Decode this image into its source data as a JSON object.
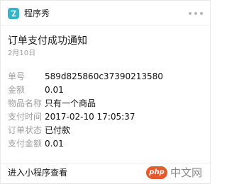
{
  "header": {
    "app_name": "程序秀",
    "icon": "mini-program-icon",
    "more_icon": "more-icon"
  },
  "message": {
    "title": "订单支付成功通知",
    "date": "2月10日"
  },
  "details": [
    {
      "label": "单号",
      "value": "589d825860c37390213580"
    },
    {
      "label": "金额",
      "value": "0.01"
    },
    {
      "label": "物品名称",
      "value": "只有一个商品"
    },
    {
      "label": "支付时间",
      "value": "2017-02-10 17:05:37"
    },
    {
      "label": "订单状态",
      "value": "已付款"
    },
    {
      "label": "支付金额",
      "value": "0.01"
    }
  ],
  "footer": {
    "link_label": "进入小程序查看"
  },
  "watermark": {
    "logo_text": "php",
    "text": "中文网"
  },
  "colors": {
    "app_icon": "#35b3c9",
    "watermark_logo": "#e35b2a"
  }
}
